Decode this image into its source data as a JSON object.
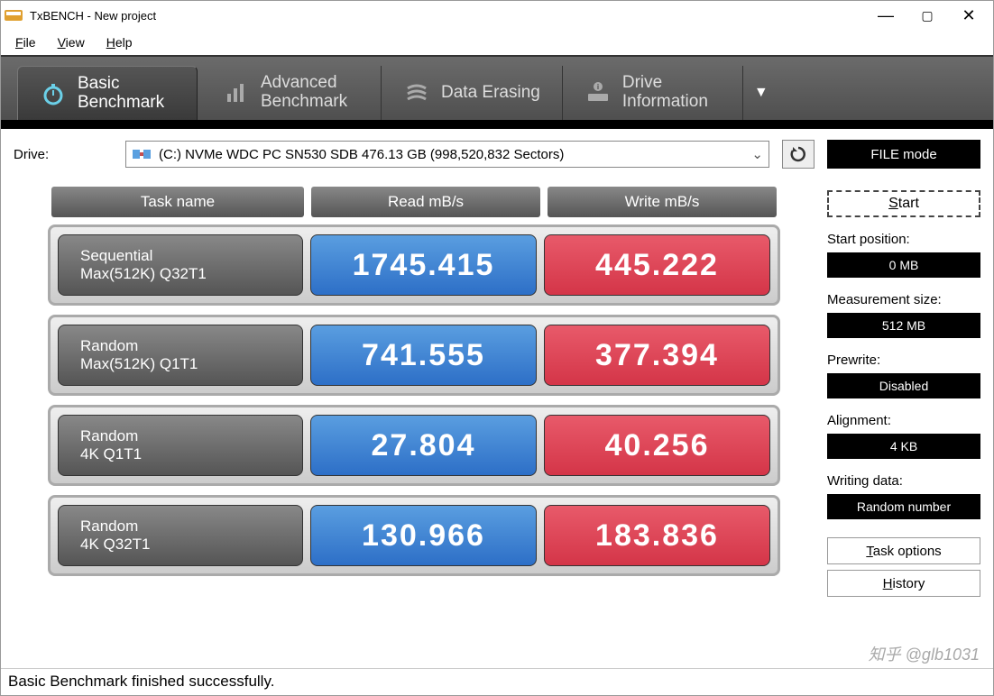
{
  "window": {
    "title": "TxBENCH - New project"
  },
  "menu": {
    "file": "File",
    "view": "View",
    "help": "Help"
  },
  "tabs": {
    "basic": {
      "line1": "Basic",
      "line2": "Benchmark"
    },
    "advanced": {
      "line1": "Advanced",
      "line2": "Benchmark"
    },
    "erasing": {
      "line1": "Data Erasing"
    },
    "drive": {
      "line1": "Drive",
      "line2": "Information"
    }
  },
  "drive_row": {
    "label": "Drive:",
    "value": "(C:) NVMe WDC PC SN530 SDB  476.13 GB (998,520,832 Sectors)",
    "mode": "FILE mode"
  },
  "headers": {
    "task": "Task name",
    "read": "Read mB/s",
    "write": "Write mB/s"
  },
  "rows": [
    {
      "task_l1": "Sequential",
      "task_l2": "Max(512K) Q32T1",
      "read": "1745.415",
      "write": "445.222"
    },
    {
      "task_l1": "Random",
      "task_l2": "Max(512K) Q1T1",
      "read": "741.555",
      "write": "377.394"
    },
    {
      "task_l1": "Random",
      "task_l2": "4K Q1T1",
      "read": "27.804",
      "write": "40.256"
    },
    {
      "task_l1": "Random",
      "task_l2": "4K Q32T1",
      "read": "130.966",
      "write": "183.836"
    }
  ],
  "sidebar": {
    "start": "Start",
    "start_pos_lbl": "Start position:",
    "start_pos_val": "0 MB",
    "meas_lbl": "Measurement size:",
    "meas_val": "512 MB",
    "prewrite_lbl": "Prewrite:",
    "prewrite_val": "Disabled",
    "align_lbl": "Alignment:",
    "align_val": "4 KB",
    "wdata_lbl": "Writing data:",
    "wdata_val": "Random number",
    "task_opts": "Task options",
    "history": "History"
  },
  "status": "Basic Benchmark finished successfully.",
  "watermark": "知乎 @glb1031"
}
